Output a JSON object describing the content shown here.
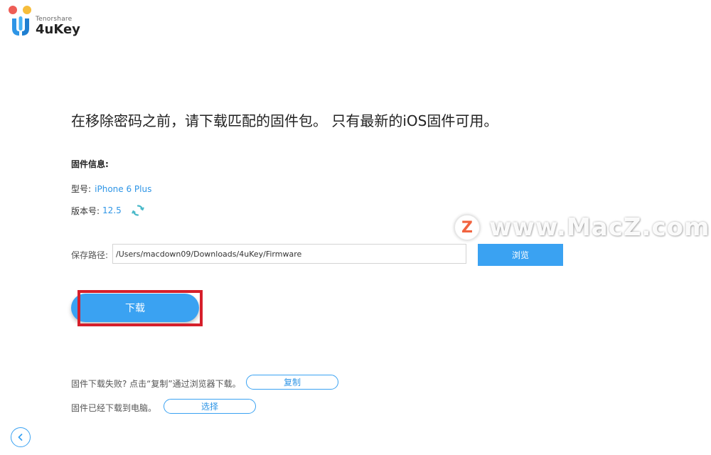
{
  "app": {
    "brand": "Tenorshare",
    "name": "4uKey"
  },
  "headline": "在移除密码之前，请下载匹配的固件包。 只有最新的iOS固件可用。",
  "firmware": {
    "title": "固件信息:",
    "model_label": "型号:",
    "model_value": "iPhone 6 Plus",
    "version_label": "版本号:",
    "version_value": "12.5"
  },
  "save": {
    "label": "保存路径:",
    "path": "/Users/macdown09/Downloads/4uKey/Firmware",
    "browse_label": "浏览"
  },
  "download_label": "下载",
  "fallback": {
    "fail_text": "固件下载失败? 点击“复制”通过浏览器下载。",
    "copy_label": "复制",
    "done_text": "固件已经下载到电脑。",
    "select_label": "选择"
  },
  "watermark": {
    "letter": "Z",
    "text": "www.MacZ.com"
  },
  "colors": {
    "accent": "#3aa2f2",
    "link": "#2e95e6",
    "highlight": "#d61f2b",
    "watermark_logo": "#f0532b"
  },
  "icons": {
    "refresh": "refresh-icon",
    "back": "back-arrow-icon"
  }
}
